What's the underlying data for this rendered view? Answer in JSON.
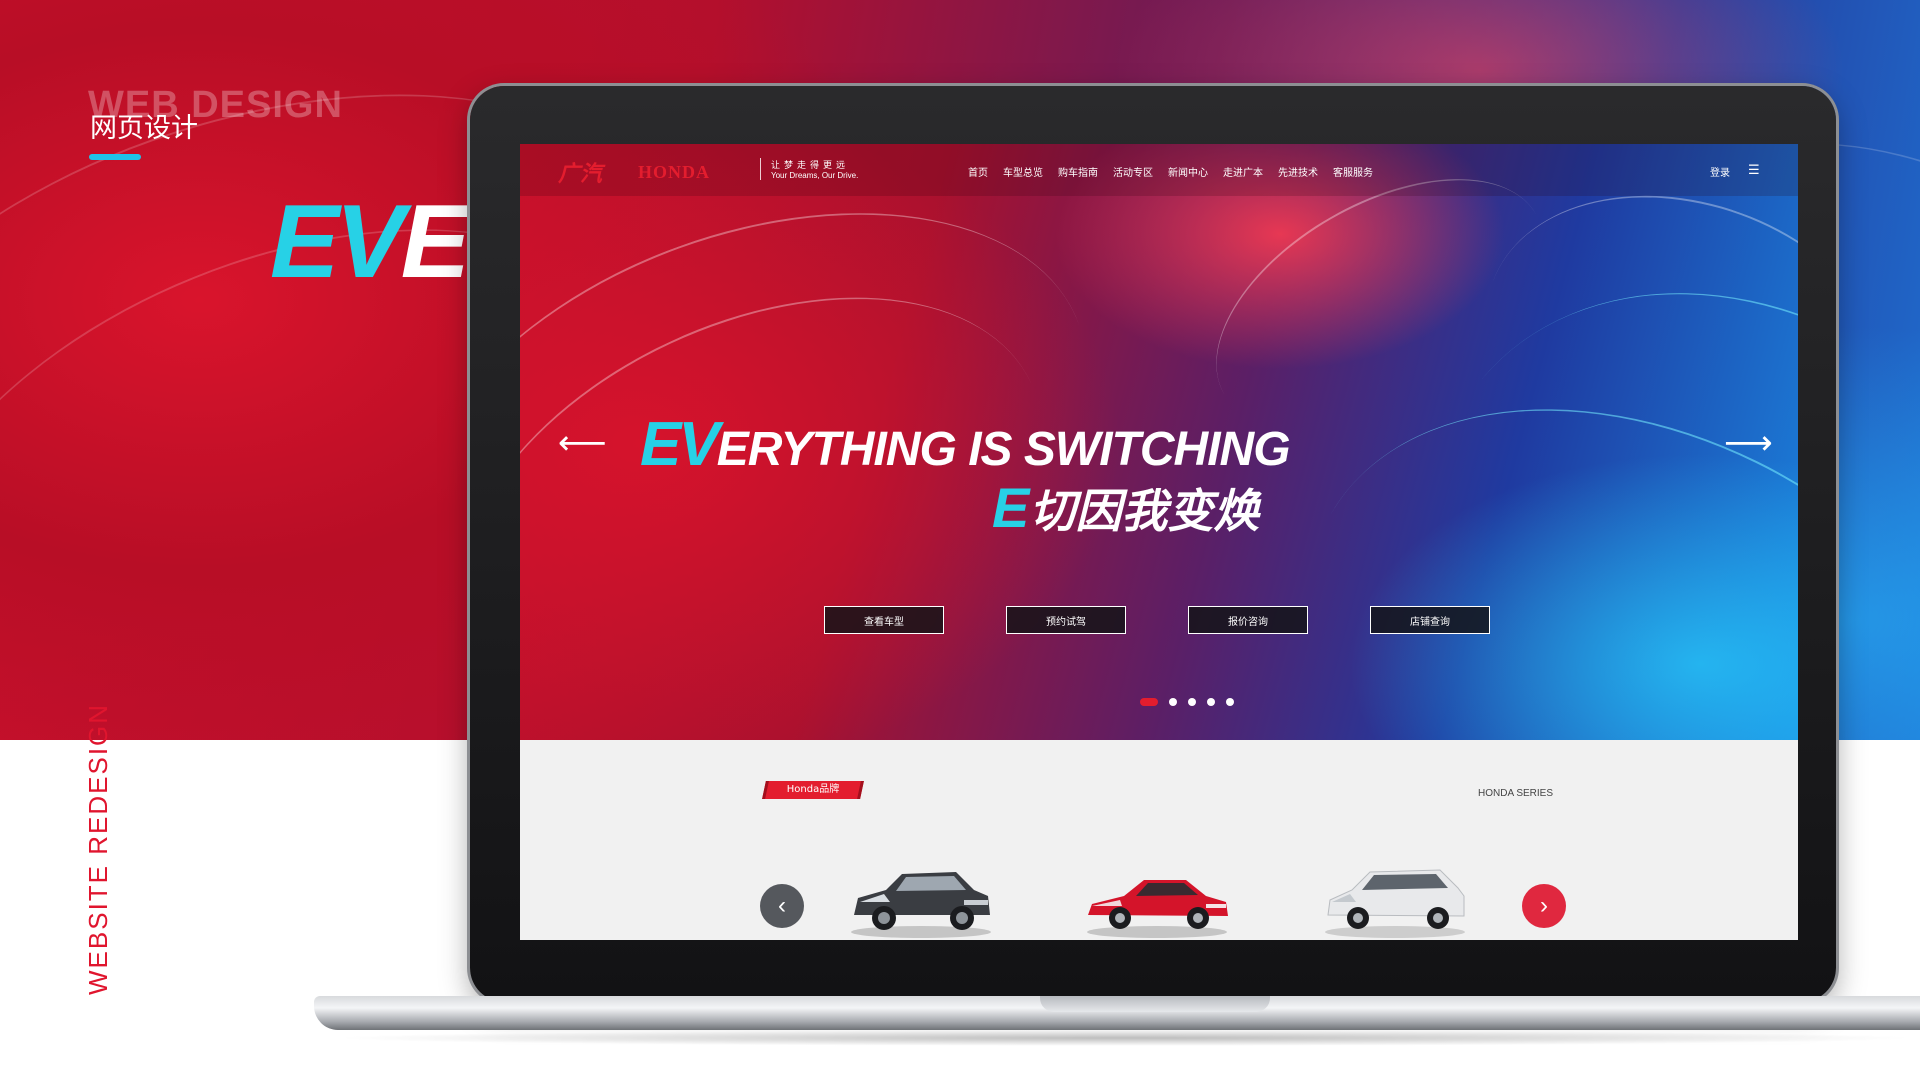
{
  "presentation": {
    "ghost_title": "WEB DESIGN",
    "title_cn": "网页设计",
    "big_ev": "EV",
    "big_rest": "EI",
    "vertical_label": "WEBSITE REDESIGN",
    "accent_color": "#20c3e8",
    "brand_red": "#e31d2e"
  },
  "site": {
    "logo": {
      "gac": "广汽",
      "honda": "HONDA",
      "slogan_cn": "让梦走得更远",
      "slogan_en": "Your Dreams, Our Drive."
    },
    "nav": {
      "items": [
        "首页",
        "车型总览",
        "购车指南",
        "活动专区",
        "新闻中心",
        "走进广本",
        "先进技术",
        "客服服务"
      ],
      "login": "登录",
      "menu_icon": "menu-icon"
    },
    "hero": {
      "headline_ev": "EV",
      "headline_rest": "ERYTHING IS SWITCHING",
      "sub_e": "E",
      "sub_rest": "切因我变焕",
      "buttons": [
        "查看车型",
        "预约试驾",
        "报价咨询",
        "店铺查询"
      ],
      "slide_count": 5,
      "active_slide": 1
    },
    "series": {
      "tag": "Honda品牌",
      "title": "HONDA SERIES",
      "cars": [
        {
          "type": "suv",
          "color": "#3a3d42"
        },
        {
          "type": "sedan",
          "color": "#d4142a"
        },
        {
          "type": "mpv",
          "color": "#e8e9eb"
        }
      ]
    }
  }
}
